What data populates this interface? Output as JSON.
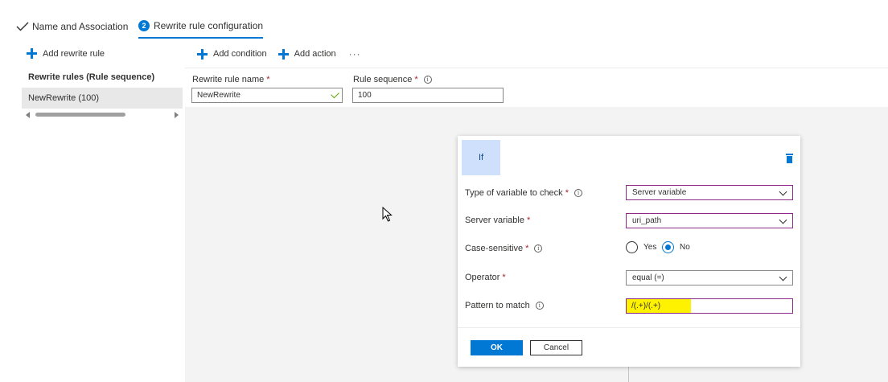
{
  "tabs": [
    {
      "label": "Name and Association",
      "state": "completed"
    },
    {
      "step": "2",
      "label": "Rewrite rule configuration",
      "state": "active"
    }
  ],
  "left_panel": {
    "add_rewrite_rule": "Add rewrite rule",
    "heading": "Rewrite rules (Rule sequence)",
    "rules": [
      "NewRewrite (100)"
    ]
  },
  "toolbar": {
    "add_condition": "Add condition",
    "add_action": "Add action",
    "more": "···"
  },
  "form": {
    "rule_name_label": "Rewrite rule name",
    "rule_name_value": "NewRewrite",
    "rule_sequence_label": "Rule sequence",
    "rule_sequence_value": "100",
    "required_mark": "*"
  },
  "condition": {
    "header": "If",
    "type_label": "Type of variable to check",
    "type_value": "Server variable",
    "server_variable_label": "Server variable",
    "server_variable_value": "uri_path",
    "case_sensitive_label": "Case-sensitive",
    "case_options": [
      "Yes",
      "No"
    ],
    "case_selected": "No",
    "operator_label": "Operator",
    "operator_value": "equal (=)",
    "pattern_label": "Pattern to match",
    "pattern_value": "/(.+)/(.+)",
    "ok": "OK",
    "cancel": "Cancel"
  },
  "colors": {
    "accent": "#0078d4",
    "focus_border": "#8a2b88",
    "highlight": "#fff200",
    "if_box": "#cfe0fc"
  }
}
